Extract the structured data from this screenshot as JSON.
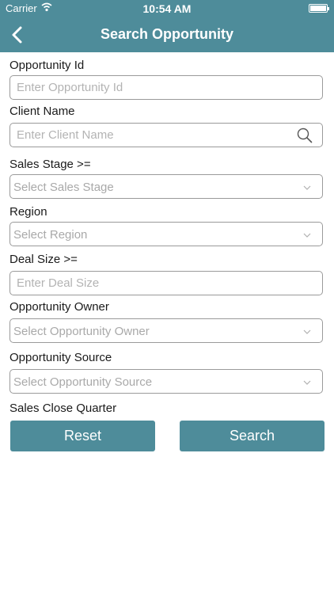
{
  "status_bar": {
    "carrier": "Carrier",
    "time": "10:54 AM"
  },
  "nav": {
    "title": "Search Opportunity",
    "back_icon": "chevron-left-icon"
  },
  "form": {
    "opportunity_id": {
      "label": "Opportunity Id",
      "placeholder": "Enter Opportunity Id"
    },
    "client_name": {
      "label": "Client Name",
      "placeholder": "Enter Client Name",
      "icon": "search-icon"
    },
    "sales_stage": {
      "label": "Sales Stage >=",
      "placeholder": "Select Sales Stage"
    },
    "region": {
      "label": "Region",
      "placeholder": "Select Region"
    },
    "deal_size": {
      "label": "Deal Size >=",
      "placeholder": "Enter Deal Size"
    },
    "opportunity_owner": {
      "label": "Opportunity Owner",
      "placeholder": "Select Opportunity Owner"
    },
    "opportunity_source": {
      "label": "Opportunity Source",
      "placeholder": "Select Opportunity Source"
    },
    "sales_close_quarter": {
      "label": "Sales Close Quarter"
    }
  },
  "buttons": {
    "reset": "Reset",
    "search": "Search"
  },
  "colors": {
    "accent": "#4e8c9a",
    "border": "#9a9a9a",
    "placeholder": "#b3b3b3"
  }
}
